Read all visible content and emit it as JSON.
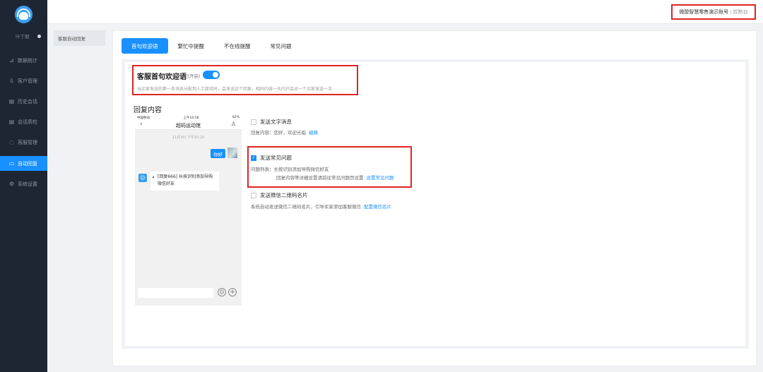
{
  "sidebar": {
    "user_name": "叶丁丽",
    "items": [
      {
        "label": "数据统计",
        "icon": "chart-icon",
        "glyph": "⊿"
      },
      {
        "label": "客户管理",
        "icon": "user-icon",
        "glyph": "♙"
      },
      {
        "label": "历史会话",
        "icon": "document-icon",
        "glyph": "▤"
      },
      {
        "label": "会话质检",
        "icon": "document-check-icon",
        "glyph": "▤"
      },
      {
        "label": "客服管理",
        "icon": "headset-icon",
        "glyph": "◌"
      },
      {
        "label": "自动回复",
        "icon": "chat-bubble-icon",
        "glyph": "▭",
        "active": true
      },
      {
        "label": "系统设置",
        "icon": "gear-icon",
        "glyph": "⚙"
      }
    ]
  },
  "topbar": {
    "account_name": "微盟智慧零售演示账号",
    "separator": "|",
    "console_link": "控制台"
  },
  "subside": {
    "label": "客服自动回复"
  },
  "tabs": [
    "首句欢迎语",
    "繁忙中提醒",
    "不在线提醒",
    "常见问题"
  ],
  "welcome": {
    "title": "客服首句欢迎语",
    "status": "(已开启)",
    "enabled": true,
    "description": "当买家发送的第一条消息分配到人工接待时，会发送这个回复。相同内容一天内只会对一个买家发送一次"
  },
  "reply": {
    "title": "回复内容",
    "options": [
      {
        "label": "发送文字消息",
        "checked": false,
        "sub_text": "回复内容：您好，欢迎光临",
        "sub_link": "编辑"
      },
      {
        "label": "发送常见问题",
        "checked": true,
        "sub_text": "问题列表：长按识别添加导购微信好友",
        "sub_text2": "回复内容等详细设置请前往常见问题页设置",
        "sub_link": "设置常见问题"
      },
      {
        "label": "发送微信二维码名片",
        "checked": false,
        "sub_text": "系统自动发送微信二维码名片，引导买家添加客服微信",
        "sub_link": "配置微信名片"
      }
    ]
  },
  "phone": {
    "carrier": "中国移动",
    "time": "上午10:58",
    "battery": "82%",
    "shop_name": "超码运动馆",
    "chat_time": "11月3日 下午16:20",
    "user_message": "你好",
    "bot_message": "[回复666] 长按识别添加导购微信好友"
  },
  "colors": {
    "accent": "#1890ff",
    "sidebar": "#1f2633",
    "highlight": "#e02424"
  }
}
